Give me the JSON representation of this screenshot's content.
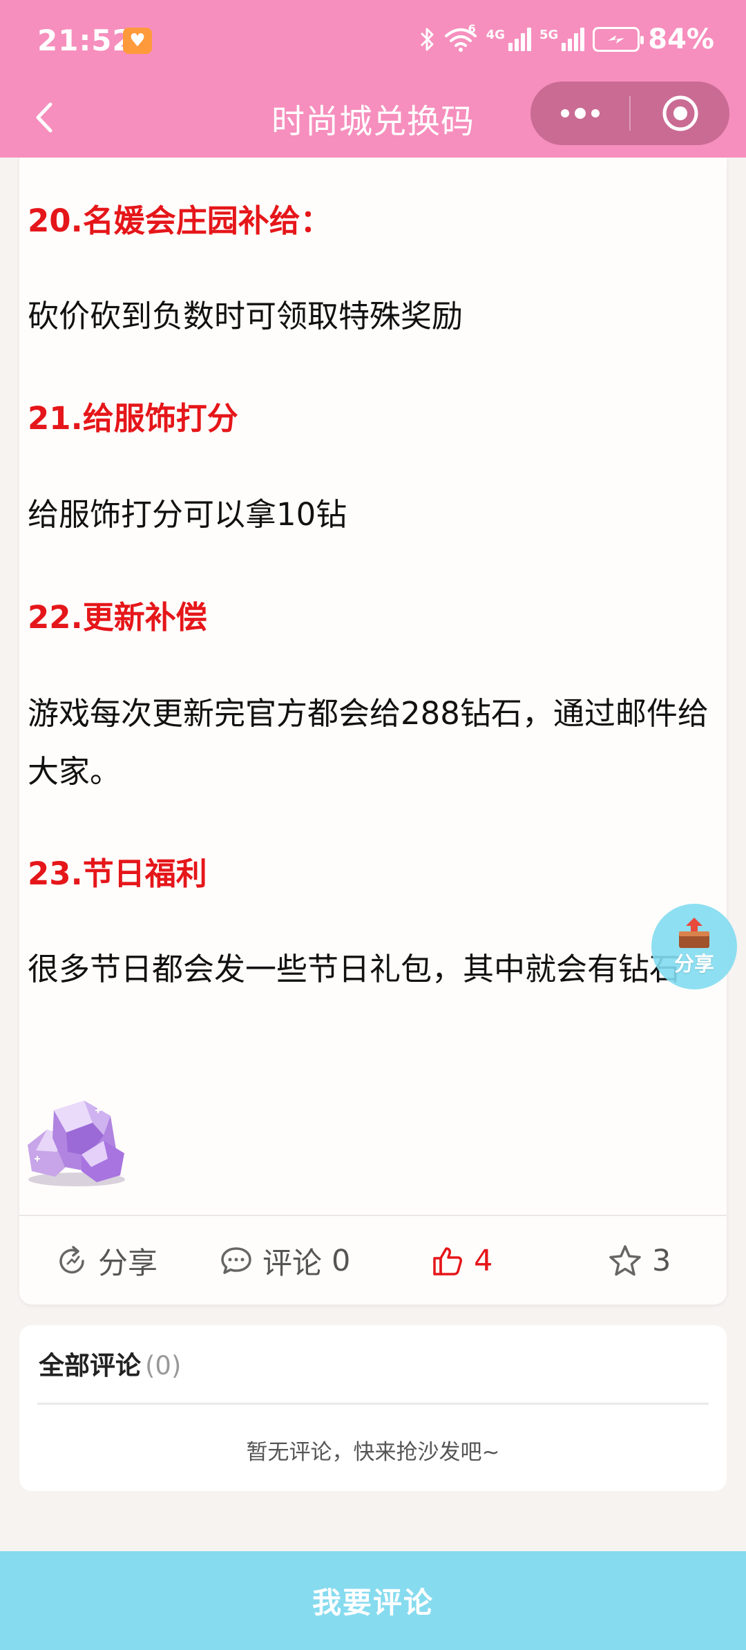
{
  "status_bar": {
    "time": "21:52",
    "network_1": "4G",
    "network_2": "5G",
    "battery": "84%",
    "wifi_superscript": "6"
  },
  "header": {
    "title": "时尚城兑换码",
    "back_icon": "chevron-left-icon",
    "more_icon": "more-dots-icon",
    "target_icon": "target-icon"
  },
  "article": {
    "sections": [
      {
        "heading": "20.名媛会庄园补给：",
        "text": "砍价砍到负数时可领取特殊奖励"
      },
      {
        "heading": "21.给服饰打分",
        "text": "给服饰打分可以拿10钻"
      },
      {
        "heading": "22.更新补偿",
        "text": "游戏每次更新完官方都会给288钻石，通过邮件给大家。"
      },
      {
        "heading": "23.节日福利",
        "text": "很多节日都会发一些节日礼包，其中就会有钻石"
      }
    ],
    "image": "purple-diamond-gems"
  },
  "actions": {
    "share_label": "分享",
    "comment_label": "评论",
    "comment_count": "0",
    "like_count": "4",
    "favorite_count": "3"
  },
  "comments": {
    "title": "全部评论",
    "count": "(0)",
    "empty_text": "暂无评论，快来抢沙发吧~"
  },
  "fab": {
    "label": "分享"
  },
  "bottom_bar": {
    "label": "我要评论"
  },
  "colors": {
    "brand_pink": "#f68fbd",
    "heading_red": "#e5161a",
    "accent_cyan": "#86dbef"
  }
}
